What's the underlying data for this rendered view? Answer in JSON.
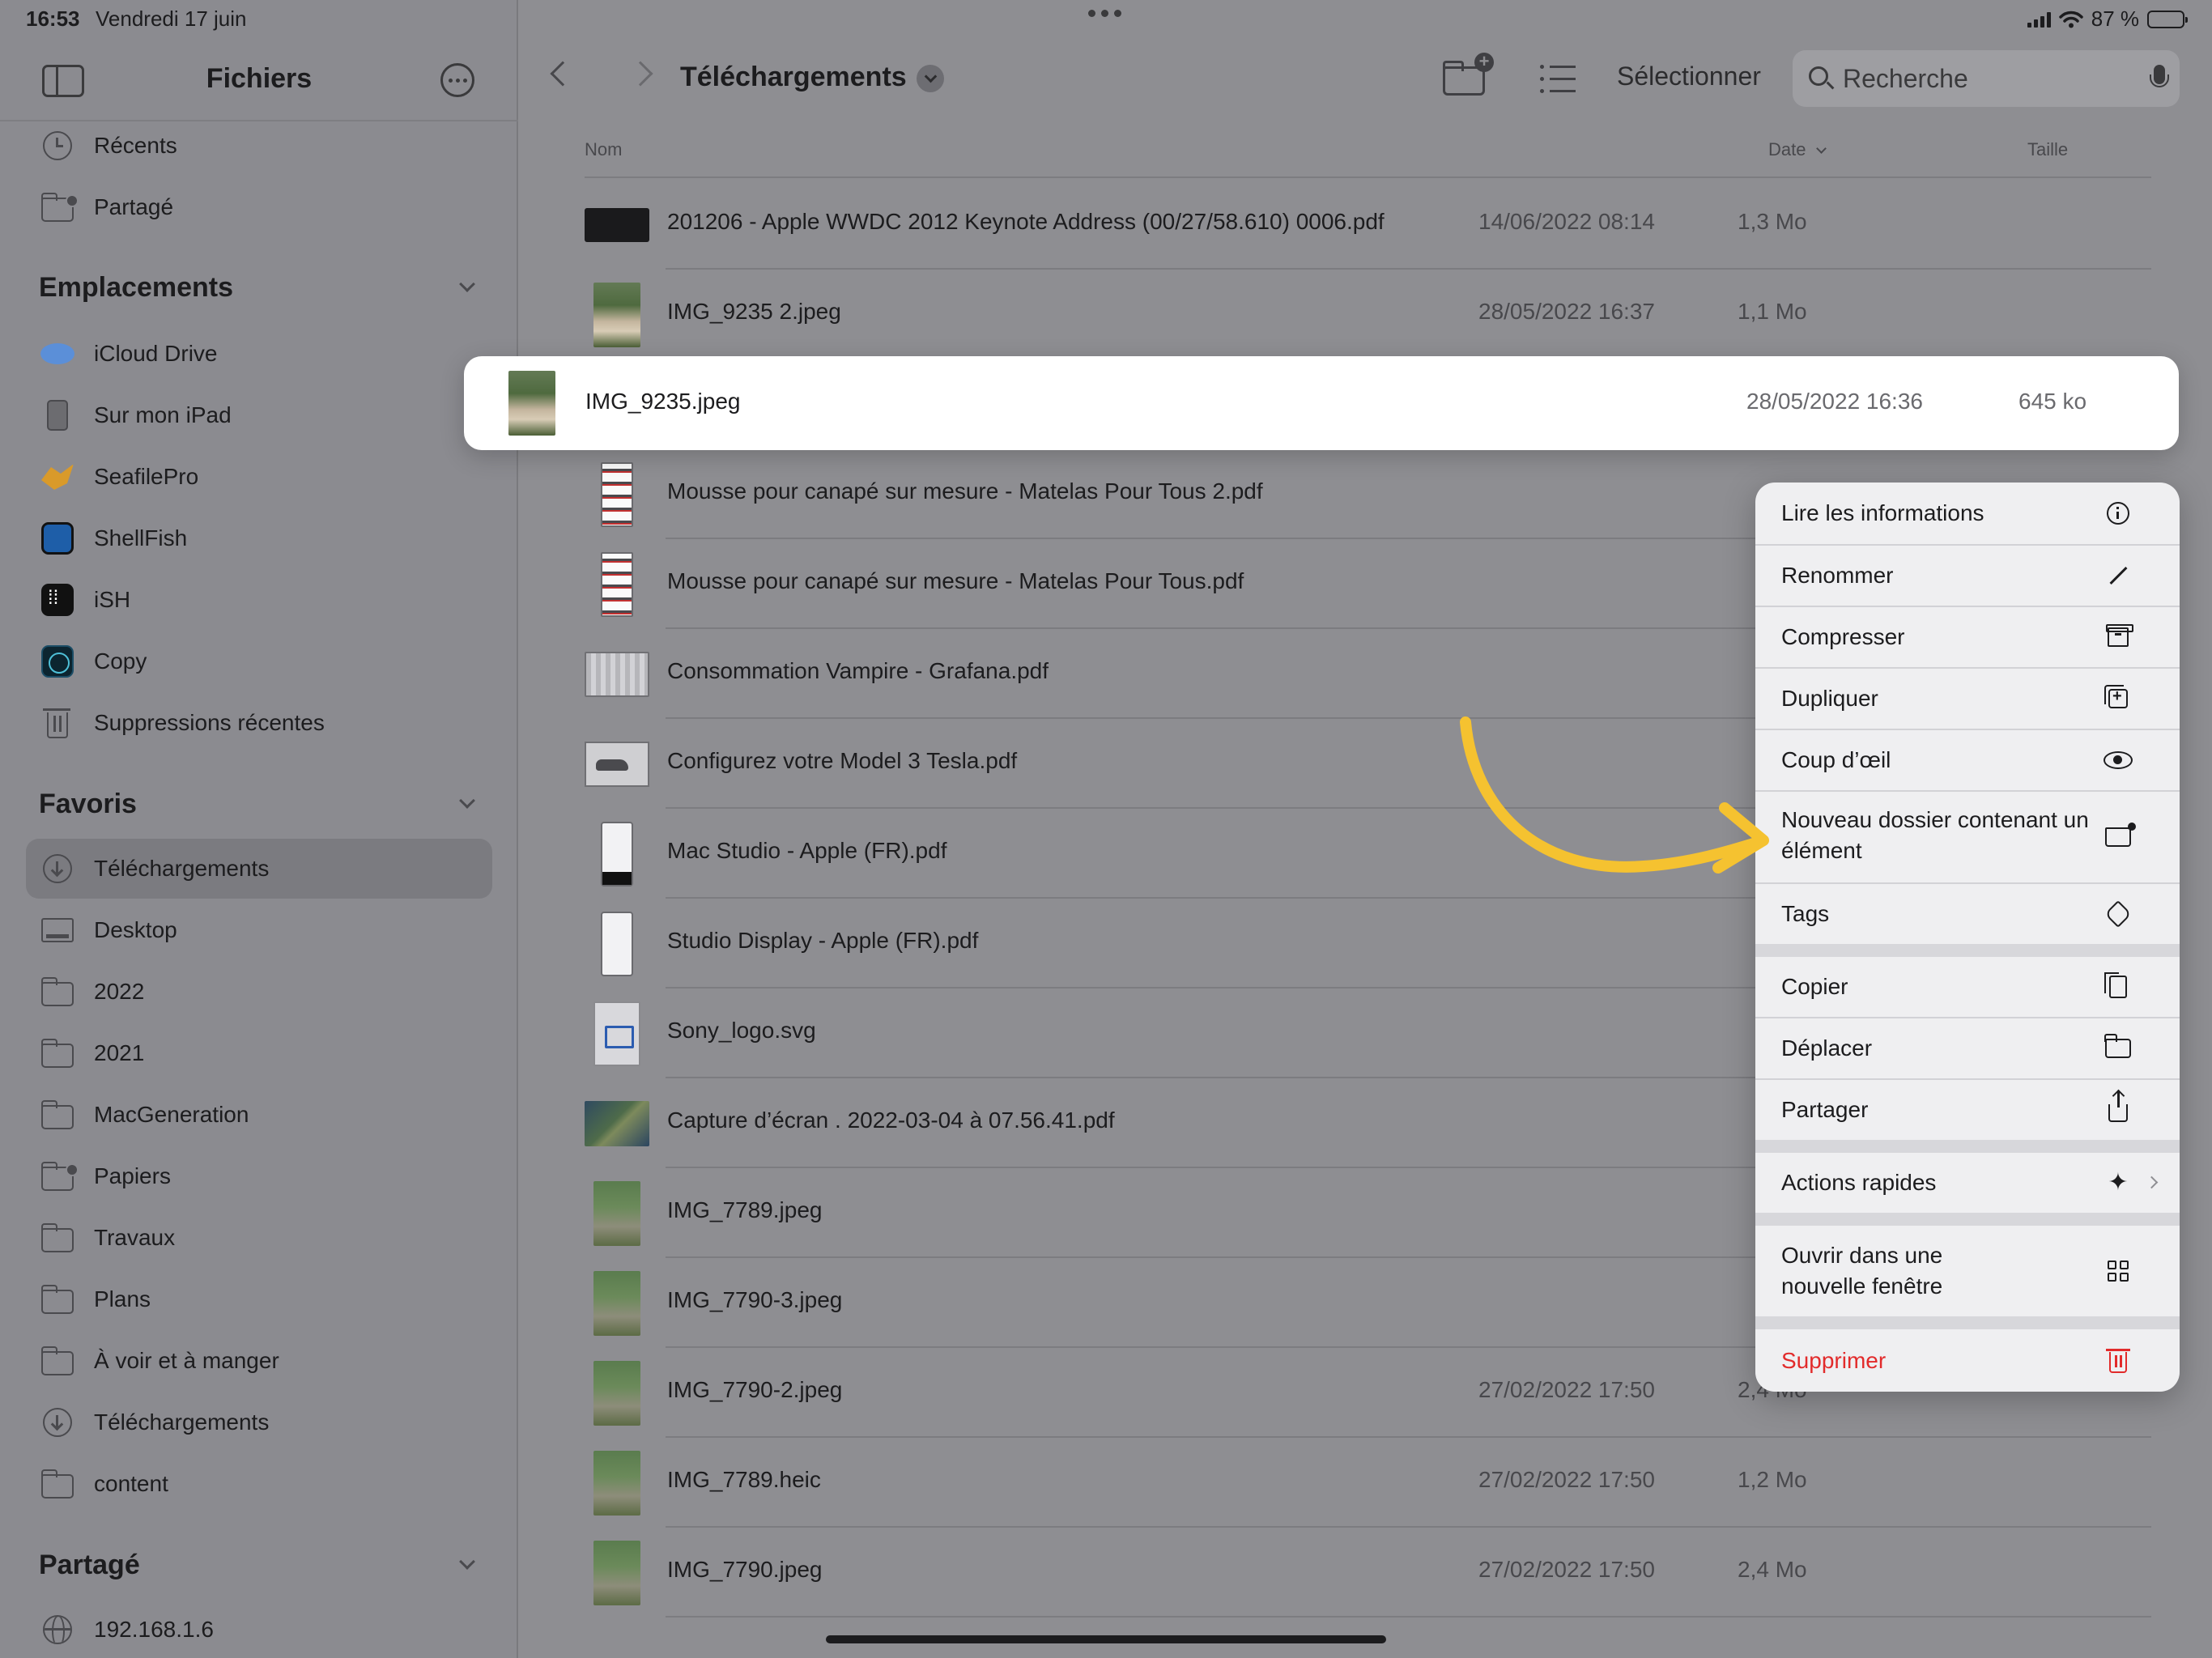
{
  "status_bar": {
    "time": "16:53",
    "date": "Vendredi 17 juin",
    "battery": "87 %",
    "battery_level": 0.87
  },
  "sidebar": {
    "title": "Fichiers",
    "top_items": [
      {
        "label": "Récents",
        "icon": "clock-icon"
      },
      {
        "label": "Partagé",
        "icon": "shared-folder-icon"
      }
    ],
    "sections": {
      "locations": {
        "title": "Emplacements",
        "items": [
          {
            "label": "iCloud Drive",
            "icon": "icloud-icon"
          },
          {
            "label": "Sur mon iPad",
            "icon": "ipad-icon"
          },
          {
            "label": "SeafilePro",
            "icon": "seafile-icon"
          },
          {
            "label": "ShellFish",
            "icon": "shellfish-icon"
          },
          {
            "label": "iSH",
            "icon": "ish-icon"
          },
          {
            "label": "Copy",
            "icon": "copy-app-icon"
          },
          {
            "label": "Suppressions récentes",
            "icon": "trash-icon"
          }
        ]
      },
      "favorites": {
        "title": "Favoris",
        "items": [
          {
            "label": "Téléchargements",
            "icon": "download-circle-icon",
            "active": true
          },
          {
            "label": "Desktop",
            "icon": "desktop-icon"
          },
          {
            "label": "2022",
            "icon": "folder-icon"
          },
          {
            "label": "2021",
            "icon": "folder-icon"
          },
          {
            "label": "MacGeneration",
            "icon": "folder-icon"
          },
          {
            "label": "Papiers",
            "icon": "shared-folder-icon"
          },
          {
            "label": "Travaux",
            "icon": "folder-icon"
          },
          {
            "label": "Plans",
            "icon": "folder-icon"
          },
          {
            "label": "À voir et à manger",
            "icon": "folder-icon"
          },
          {
            "label": "Téléchargements",
            "icon": "download-circle-icon"
          },
          {
            "label": "content",
            "icon": "folder-icon"
          }
        ]
      },
      "shared": {
        "title": "Partagé",
        "items": [
          {
            "label": "192.168.1.6",
            "icon": "globe-icon"
          }
        ]
      }
    }
  },
  "toolbar": {
    "folder_title": "Téléchargements",
    "select_label": "Sélectionner",
    "search_placeholder": "Recherche"
  },
  "columns": {
    "name": "Nom",
    "date": "Date",
    "size": "Taille"
  },
  "files": [
    {
      "name": "201206 - Apple WWDC 2012 Keynote Address (00/27/58.610) 0006.pdf",
      "date": "14/06/2022 08:14",
      "size": "1,3 Mo",
      "thumb": "pdf-dark"
    },
    {
      "name": "IMG_9235 2.jpeg",
      "date": "28/05/2022 16:37",
      "size": "1,1 Mo",
      "thumb": "photo-road"
    },
    {
      "name": "IMG_9235.jpeg",
      "date": "28/05/2022 16:36",
      "size": "645 ko",
      "thumb": "photo-road",
      "highlighted": true
    },
    {
      "name": "Mousse pour canapé sur mesure - Matelas Pour Tous 2.pdf",
      "date": "",
      "size": "",
      "thumb": "doc-stripes"
    },
    {
      "name": "Mousse pour canapé sur mesure - Matelas Pour Tous.pdf",
      "date": "",
      "size": "",
      "thumb": "doc-stripes"
    },
    {
      "name": "Consommation Vampire - Grafana.pdf",
      "date": "",
      "size": "",
      "thumb": "wide-grid"
    },
    {
      "name": "Configurez votre Model 3  Tesla.pdf",
      "date": "",
      "size": "",
      "thumb": "tesla"
    },
    {
      "name": "Mac Studio - Apple (FR).pdf",
      "date": "",
      "size": "",
      "thumb": "phone-dark"
    },
    {
      "name": "Studio Display - Apple (FR).pdf",
      "date": "",
      "size": "",
      "thumb": "phone"
    },
    {
      "name": "Sony_logo.svg",
      "date": "",
      "size": "",
      "thumb": "svg"
    },
    {
      "name": "Capture d’écran . 2022-03-04 à 07.56.41.pdf",
      "date": "",
      "size": "",
      "thumb": "map"
    },
    {
      "name": "IMG_7789.jpeg",
      "date": "",
      "size": "",
      "thumb": "photo"
    },
    {
      "name": "IMG_7790-3.jpeg",
      "date": "",
      "size": "",
      "thumb": "photo"
    },
    {
      "name": "IMG_7790-2.jpeg",
      "date": "27/02/2022 17:50",
      "size": "2,4 Mo",
      "thumb": "photo"
    },
    {
      "name": "IMG_7789.heic",
      "date": "27/02/2022 17:50",
      "size": "1,2 Mo",
      "thumb": "photo"
    },
    {
      "name": "IMG_7790.jpeg",
      "date": "27/02/2022 17:50",
      "size": "2,4 Mo",
      "thumb": "photo"
    }
  ],
  "context_menu": {
    "items": [
      {
        "label": "Lire les informations",
        "icon": "info-icon"
      },
      {
        "label": "Renommer",
        "icon": "pencil-icon"
      },
      {
        "label": "Compresser",
        "icon": "archive-icon"
      },
      {
        "label": "Dupliquer",
        "icon": "duplicate-icon"
      },
      {
        "label": "Coup d’œil",
        "icon": "eye-icon"
      },
      {
        "label": "Nouveau dossier contenant un élément",
        "icon": "folder-badge-icon"
      },
      {
        "label": "Tags",
        "icon": "tag-icon"
      },
      {
        "label": "Copier",
        "icon": "copy-icon"
      },
      {
        "label": "Déplacer",
        "icon": "folder-icon"
      },
      {
        "label": "Partager",
        "icon": "share-icon"
      },
      {
        "label": "Actions rapides",
        "icon": "sparkles-icon"
      },
      {
        "label": "Ouvrir dans une nouvelle fenêtre",
        "icon": "grid-icon"
      },
      {
        "label": "Supprimer",
        "icon": "trash-icon",
        "destructive": true
      }
    ]
  },
  "colors": {
    "accent_annotation": "#f5c230",
    "destructive": "#e22b2b",
    "dimmed_background": "#8e8e92",
    "menu_background": "#efeff1"
  }
}
